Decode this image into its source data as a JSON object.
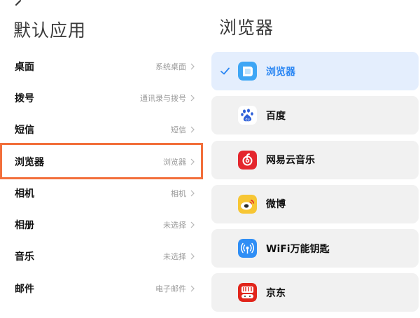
{
  "left_panel": {
    "title": "默认应用",
    "settings": [
      {
        "label": "桌面",
        "value": "系统桌面"
      },
      {
        "label": "拨号",
        "value": "通讯录与拨号"
      },
      {
        "label": "短信",
        "value": "短信"
      },
      {
        "label": "浏览器",
        "value": "浏览器"
      },
      {
        "label": "相机",
        "value": "相机"
      },
      {
        "label": "相册",
        "value": "未选择"
      },
      {
        "label": "音乐",
        "value": "未选择"
      },
      {
        "label": "邮件",
        "value": "电子邮件"
      }
    ],
    "highlighted_index": 3
  },
  "right_panel": {
    "title": "浏览器",
    "apps": [
      {
        "name": "浏览器",
        "icon": "mi-browser-icon",
        "selected": true
      },
      {
        "name": "百度",
        "icon": "baidu-icon",
        "selected": false
      },
      {
        "name": "网易云音乐",
        "icon": "netease-music-icon",
        "selected": false
      },
      {
        "name": "微博",
        "icon": "weibo-icon",
        "selected": false
      },
      {
        "name": "WiFi万能钥匙",
        "icon": "wifi-key-icon",
        "selected": false
      },
      {
        "name": "京东",
        "icon": "jd-icon",
        "selected": false
      }
    ]
  },
  "colors": {
    "accent": "#2a86f3",
    "highlight_border": "#f26f3b",
    "selected_card": "#e4eefd",
    "card": "#f1f1f1"
  }
}
